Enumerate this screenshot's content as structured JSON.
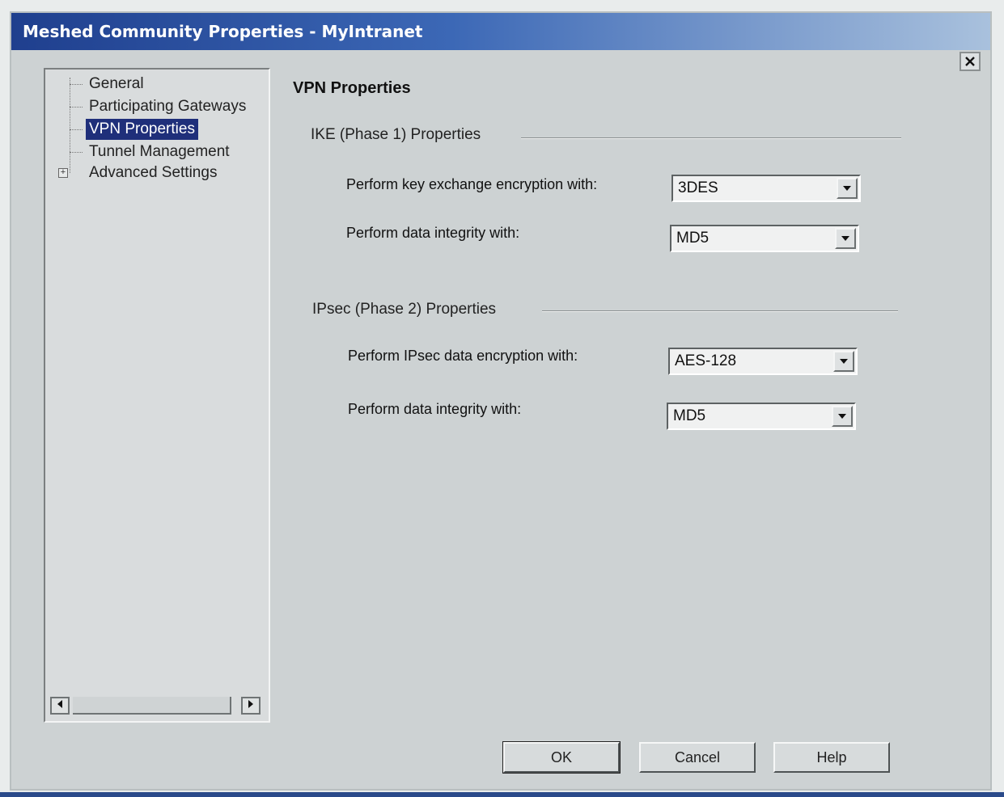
{
  "window": {
    "title": "Meshed Community Properties - MyIntranet"
  },
  "tree": {
    "items": [
      {
        "label": "General"
      },
      {
        "label": "Participating Gateways"
      },
      {
        "label": "VPN Properties",
        "selected": true
      },
      {
        "label": "Tunnel Management"
      },
      {
        "label": "Advanced Settings",
        "expandable": true
      }
    ]
  },
  "content": {
    "title": "VPN Properties",
    "ike": {
      "group_label": "IKE (Phase 1) Properties",
      "key_exchange_label": "Perform key exchange encryption with:",
      "key_exchange_value": "3DES",
      "integrity_label": "Perform data integrity with:",
      "integrity_value": "MD5"
    },
    "ipsec": {
      "group_label": "IPsec (Phase 2) Properties",
      "encryption_label": "Perform IPsec data encryption with:",
      "encryption_value": "AES-128",
      "integrity_label": "Perform data integrity with:",
      "integrity_value": "MD5"
    }
  },
  "buttons": {
    "ok": "OK",
    "cancel": "Cancel",
    "help": "Help"
  },
  "icons": {
    "close": "close-icon",
    "dropdown": "chevron-down-icon",
    "expand": "plus-expander-icon",
    "scroll_left": "arrow-left-icon",
    "scroll_right": "arrow-right-icon"
  },
  "colors": {
    "title_bar": "#1f3f8e",
    "selection": "#1f2f7a",
    "dialog_bg": "#cdd2d3"
  }
}
